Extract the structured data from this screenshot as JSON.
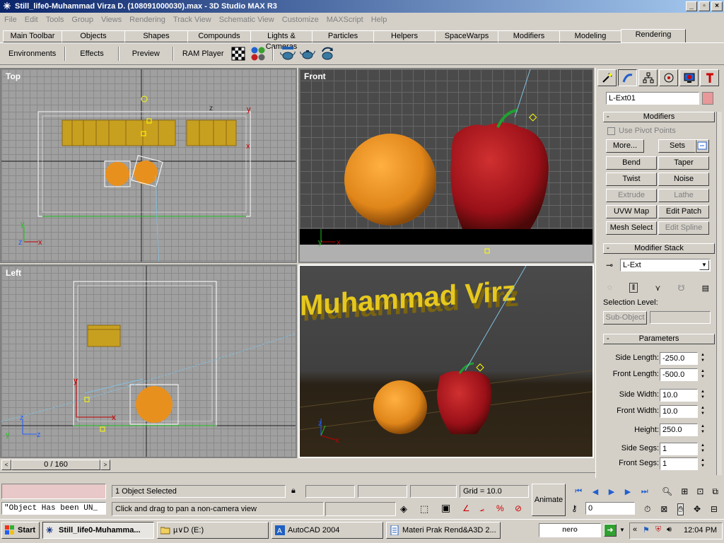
{
  "window": {
    "title": "Still_life0-Muhammad Virza D. (108091000030).max - 3D Studio MAX R3"
  },
  "menu": [
    "File",
    "Edit",
    "Tools",
    "Group",
    "Views",
    "Rendering",
    "Track View",
    "Schematic View",
    "Customize",
    "MAXScript",
    "Help"
  ],
  "tabs": [
    "Main Toolbar",
    "Objects",
    "Shapes",
    "Compounds",
    "Lights & Cameras",
    "Particles",
    "Helpers",
    "SpaceWarps",
    "Modifiers",
    "Modeling",
    "Rendering"
  ],
  "active_tab": "Rendering",
  "toolbar": {
    "environments": "Environments",
    "effects": "Effects",
    "preview": "Preview",
    "ram_player": "RAM Player"
  },
  "viewports": {
    "top": "Top",
    "front": "Front",
    "left": "Left",
    "perspective_text": "Muhammad Virz"
  },
  "panel": {
    "object_name": "L-Ext01",
    "modifiers_title": "Modifiers",
    "use_pivot": "Use Pivot Points",
    "more": "More...",
    "sets": "Sets",
    "buttons": [
      {
        "label": "Bend",
        "enabled": true
      },
      {
        "label": "Taper",
        "enabled": true
      },
      {
        "label": "Twist",
        "enabled": true
      },
      {
        "label": "Noise",
        "enabled": true
      },
      {
        "label": "Extrude",
        "enabled": false
      },
      {
        "label": "Lathe",
        "enabled": false
      },
      {
        "label": "UVW Map",
        "enabled": true
      },
      {
        "label": "Edit Patch",
        "enabled": true
      },
      {
        "label": "Mesh Select",
        "enabled": true
      },
      {
        "label": "Edit Spline",
        "enabled": false
      }
    ],
    "stack_title": "Modifier Stack",
    "stack_value": "L-Ext",
    "selection_level": "Selection Level:",
    "sub_object": "Sub-Object",
    "params_title": "Parameters",
    "params": [
      {
        "label": "Side Length:",
        "value": "-250.0"
      },
      {
        "label": "Front Length:",
        "value": "-500.0"
      },
      {
        "label": "Side Width:",
        "value": "10.0"
      },
      {
        "label": "Front Width:",
        "value": "10.0"
      },
      {
        "label": "Height:",
        "value": "250.0"
      },
      {
        "label": "Side Segs:",
        "value": "1"
      },
      {
        "label": "Front Segs:",
        "value": "1"
      }
    ]
  },
  "timeline": {
    "value": "0 / 160"
  },
  "status": {
    "selected": "1 Object Selected",
    "prompt": "Click and drag to pan a non-camera view",
    "script": "\"Object Has been UN_",
    "grid": "Grid = 10.0",
    "animate": "Animate",
    "frame": "0"
  },
  "taskbar": {
    "start": "Start",
    "items": [
      "Still_life0-Muhamma...",
      "µ∨D (E:)",
      "AutoCAD 2004",
      "Materi Prak Rend&A3D 2..."
    ],
    "time": "12:04 PM",
    "nero": "nero"
  },
  "colors": {
    "title_start": "#0a246a",
    "title_end": "#a6caf0",
    "orange": "#e8901e",
    "apple": "#a8121a",
    "text3d": "#e6c81e"
  }
}
